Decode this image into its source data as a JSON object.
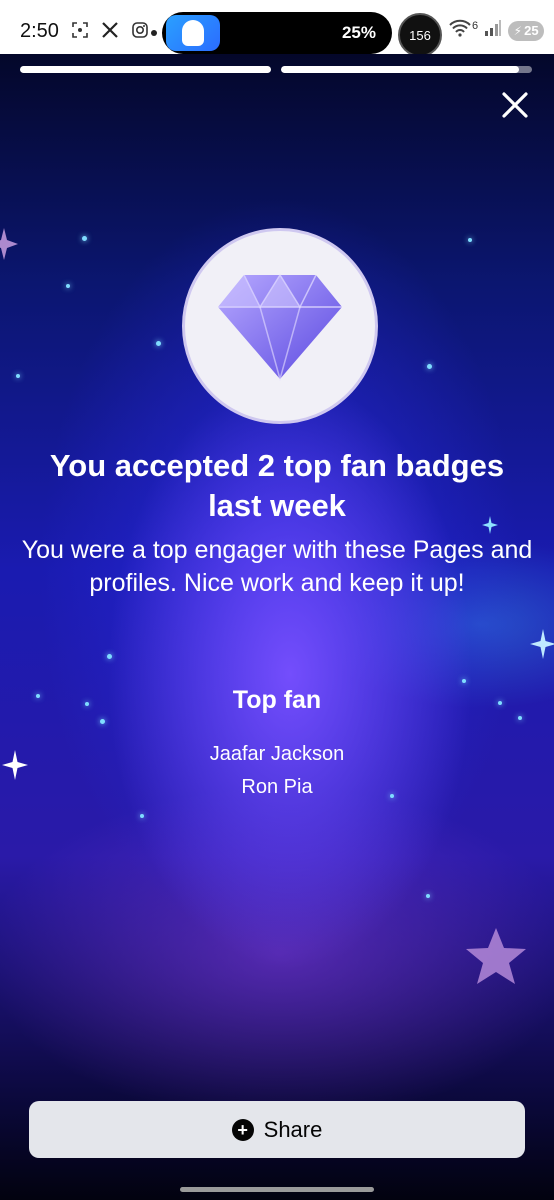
{
  "status_bar": {
    "time": "2:50",
    "notification_icons": [
      "screenshot-icon",
      "x-icon",
      "instagram-icon"
    ],
    "live_activity_percent": "25%",
    "notification_count": "156",
    "network": "6",
    "battery": "25"
  },
  "story": {
    "progress_segments": [
      1.0,
      0.95
    ],
    "headline": "You accepted 2 top fan badges last week",
    "subtext": "You were a top engager with these Pages and profiles. Nice work and keep it up!",
    "section_title": "Top fan",
    "names": [
      "Jaafar Jackson",
      "Ron Pia"
    ],
    "badge_icon": "diamond-icon"
  },
  "actions": {
    "share_label": "Share",
    "close_icon": "close-icon"
  },
  "colors": {
    "background_top": "#0b1670",
    "background_mid": "#2a1aa8",
    "share_button_bg": "#e4e6eb",
    "diamond": "#8b7cf6"
  }
}
